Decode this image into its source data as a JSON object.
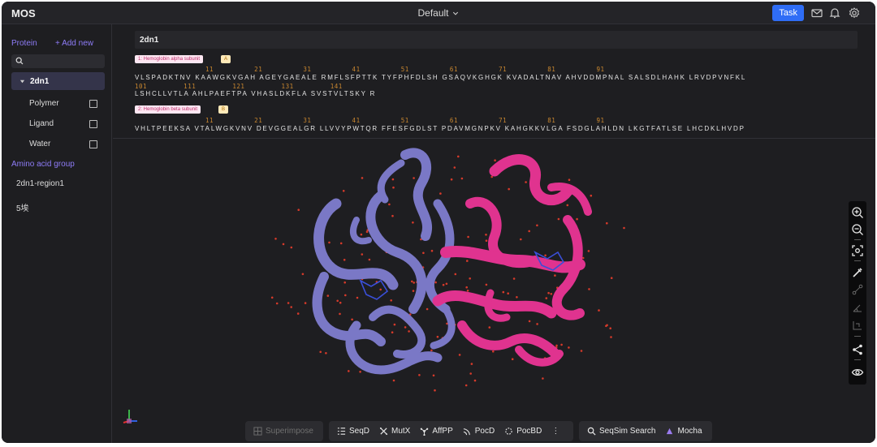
{
  "app": {
    "title": "MOS",
    "workspace": "Default",
    "task_label": "Task"
  },
  "sidebar": {
    "section_label": "Protein",
    "add_new_label": "+ Add new",
    "search_placeholder": "",
    "selected_item": "2dn1",
    "sub_items": [
      "Polymer",
      "Ligand",
      "Water"
    ],
    "group_label": "Amino acid group",
    "group_items": [
      "2dn1-region1",
      "5埃"
    ]
  },
  "sequence": {
    "title": "2dn1",
    "chains": [
      {
        "name": "1: Hemoglobin alpha subunit",
        "badge": "A",
        "row1_nums": "11          21          31          41          51          61          71          81          91",
        "row1": "VLSPADKTNV KAAWGKVGAH AGEYGAEALE RMFLSFPTTK TYFPHFDLSH GSAQVKGHGK KVADALTNAV AHVDDMPNAL SALSDLHAHK LRVDPVNFKL",
        "row2_nums": "101         111         121         131         141",
        "row2": "LSHCLLVTLA AHLPAEFTPA VHASLDKFLA SVSTVLTSKY R"
      },
      {
        "name": "2: Hemoglobin beta subunit",
        "badge": "B",
        "row1_nums": "11          21          31          41          51          61          71          81          91",
        "row1": "VHLTPEEKSA VTALWGKVNV DEVGGEALGR LLVVYPWTQR FFESFGDLST PDAVMGNPKV KAHGKKVLGA FSDGLAHLDN LKGTFATLSE LHCDKLHVDP"
      }
    ]
  },
  "viewer": {
    "chain_colors": {
      "A": "#7a78c6",
      "B": "#e0338f",
      "water": "#d63a2a"
    }
  },
  "toolbar": {
    "superimpose": "Superimpose",
    "tools": [
      "SeqD",
      "MutX",
      "AffPP",
      "PocD",
      "PocBD"
    ],
    "more": "⋮",
    "search": [
      "SeqSim Search",
      "Mocha"
    ]
  }
}
